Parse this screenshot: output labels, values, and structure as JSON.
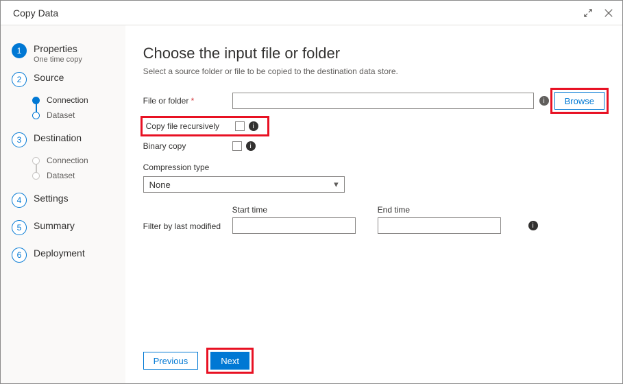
{
  "header": {
    "title": "Copy Data"
  },
  "sidebar": {
    "steps": [
      {
        "num": "1",
        "label": "Properties",
        "sublabel": "One time copy"
      },
      {
        "num": "2",
        "label": "Source"
      },
      {
        "num": "3",
        "label": "Destination"
      },
      {
        "num": "4",
        "label": "Settings"
      },
      {
        "num": "5",
        "label": "Summary"
      },
      {
        "num": "6",
        "label": "Deployment"
      }
    ],
    "source_subs": [
      {
        "label": "Connection"
      },
      {
        "label": "Dataset"
      }
    ],
    "dest_subs": [
      {
        "label": "Connection"
      },
      {
        "label": "Dataset"
      }
    ]
  },
  "main": {
    "heading": "Choose the input file or folder",
    "subtitle": "Select a source folder or file to be copied to the destination data store.",
    "labels": {
      "file_or_folder": "File or folder",
      "browse": "Browse",
      "copy_recursive": "Copy file recursively",
      "binary_copy": "Binary copy",
      "compression_type": "Compression type",
      "filter_modified": "Filter by last modified",
      "start_time": "Start time",
      "end_time": "End time"
    },
    "values": {
      "file_or_folder": "",
      "compression_type": "None",
      "start_time": "",
      "end_time": ""
    },
    "buttons": {
      "previous": "Previous",
      "next": "Next"
    }
  }
}
